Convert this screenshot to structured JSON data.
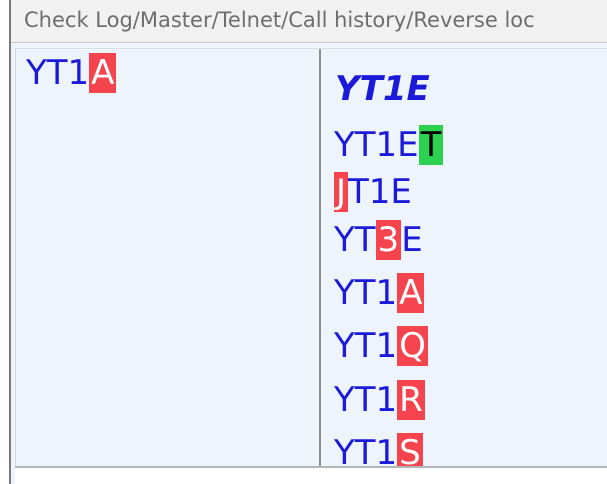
{
  "window": {
    "title": "Check Log/Master/Telnet/Call history/Reverse loc"
  },
  "left_pane": {
    "entry": {
      "prefix": "YT1",
      "highlight": "A",
      "highlight_color": "#f5444e"
    }
  },
  "right_pane": {
    "header_call": "YT1E",
    "matches": [
      {
        "before": "YT1E",
        "highlight": "T",
        "after": "",
        "highlight_color": "#2bd14f"
      },
      {
        "before": "",
        "highlight": "J",
        "after": "T1E",
        "highlight_color": "#f5444e"
      },
      {
        "before": "YT",
        "highlight": "3",
        "after": "E",
        "highlight_color": "#f5444e"
      },
      {
        "before": "YT1",
        "highlight": "A",
        "after": "",
        "highlight_color": "#f5444e"
      },
      {
        "before": "YT1",
        "highlight": "Q",
        "after": "",
        "highlight_color": "#f5444e"
      },
      {
        "before": "YT1",
        "highlight": "R",
        "after": "",
        "highlight_color": "#f5444e"
      },
      {
        "before": "YT1",
        "highlight": "S",
        "after": "",
        "highlight_color": "#f5444e"
      }
    ]
  },
  "colors": {
    "call_text": "#1a1ad8",
    "pane_background": "#eef4fb",
    "mismatch_highlight": "#f5444e",
    "extra_char_highlight": "#2bd14f"
  }
}
